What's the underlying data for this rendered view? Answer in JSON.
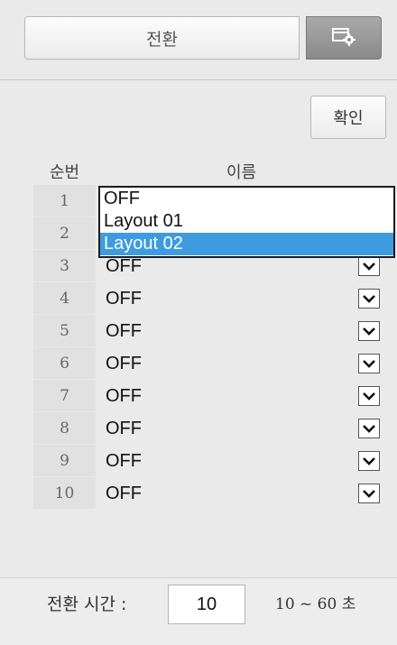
{
  "header": {
    "switch_label": "전환",
    "settings_icon": "settings-window-icon"
  },
  "confirm_label": "확인",
  "table": {
    "col_num": "순번",
    "col_name": "이름",
    "rows": [
      {
        "num": "1",
        "value": ""
      },
      {
        "num": "2",
        "value": ""
      },
      {
        "num": "3",
        "value": "OFF"
      },
      {
        "num": "4",
        "value": "OFF"
      },
      {
        "num": "5",
        "value": "OFF"
      },
      {
        "num": "6",
        "value": "OFF"
      },
      {
        "num": "7",
        "value": "OFF"
      },
      {
        "num": "8",
        "value": "OFF"
      },
      {
        "num": "9",
        "value": "OFF"
      },
      {
        "num": "10",
        "value": "OFF"
      }
    ]
  },
  "dropdown": {
    "options": [
      "OFF",
      "Layout 01",
      "Layout 02"
    ],
    "selected": "Layout 02"
  },
  "footer": {
    "time_label": "전환 시간 :",
    "time_value": "10",
    "range_text": "10 ~ 60 초"
  },
  "colors": {
    "highlight": "#3d9ce0",
    "background": "#eaeaea"
  }
}
